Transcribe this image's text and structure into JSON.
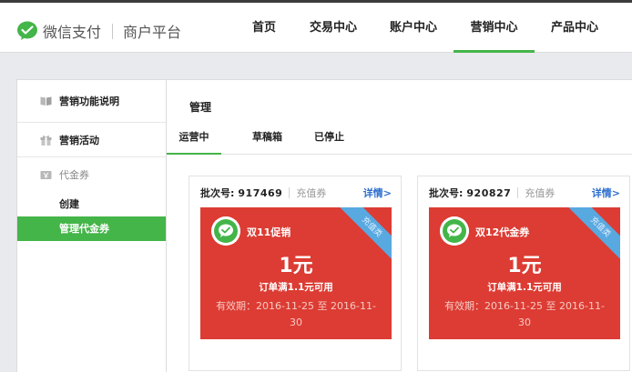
{
  "header": {
    "brand": "微信支付",
    "subtitle": "商户平台",
    "nav": [
      "首页",
      "交易中心",
      "账户中心",
      "营销中心",
      "产品中心"
    ],
    "active_nav": "营销中心"
  },
  "sidebar": {
    "groups": [
      {
        "label": "营销功能说明",
        "icon": "book-icon"
      },
      {
        "label": "营销活动",
        "icon": "gift-icon"
      },
      {
        "label": "代金券",
        "icon": "coupon-icon",
        "items": [
          "创建",
          "管理代金券"
        ],
        "active_item": "管理代金券"
      }
    ]
  },
  "main": {
    "title": "管理",
    "tabs": [
      "运营中",
      "草稿箱",
      "已停止"
    ],
    "active_tab": "运营中"
  },
  "cards": [
    {
      "batch_label": "批次号:",
      "batch_no": "917469",
      "type": "充值券",
      "detail_link": "详情>",
      "coupon_name": "双11促销",
      "ribbon": "充值类",
      "amount": "1元",
      "condition": "订单满1.1元可用",
      "validity": "有效期：2016-11-25 至 2016-11-30"
    },
    {
      "batch_label": "批次号:",
      "batch_no": "920827",
      "type": "充值券",
      "detail_link": "详情>",
      "coupon_name": "双12代金券",
      "ribbon": "充值类",
      "amount": "1元",
      "condition": "订单满1.1元可用",
      "validity": "有效期：2016-11-25 至 2016-11-30"
    }
  ],
  "colors": {
    "brand_green": "#44b549",
    "coupon_red": "#dc3c33",
    "ribbon_blue": "#58a9e0",
    "link_blue": "#2e6fce"
  }
}
